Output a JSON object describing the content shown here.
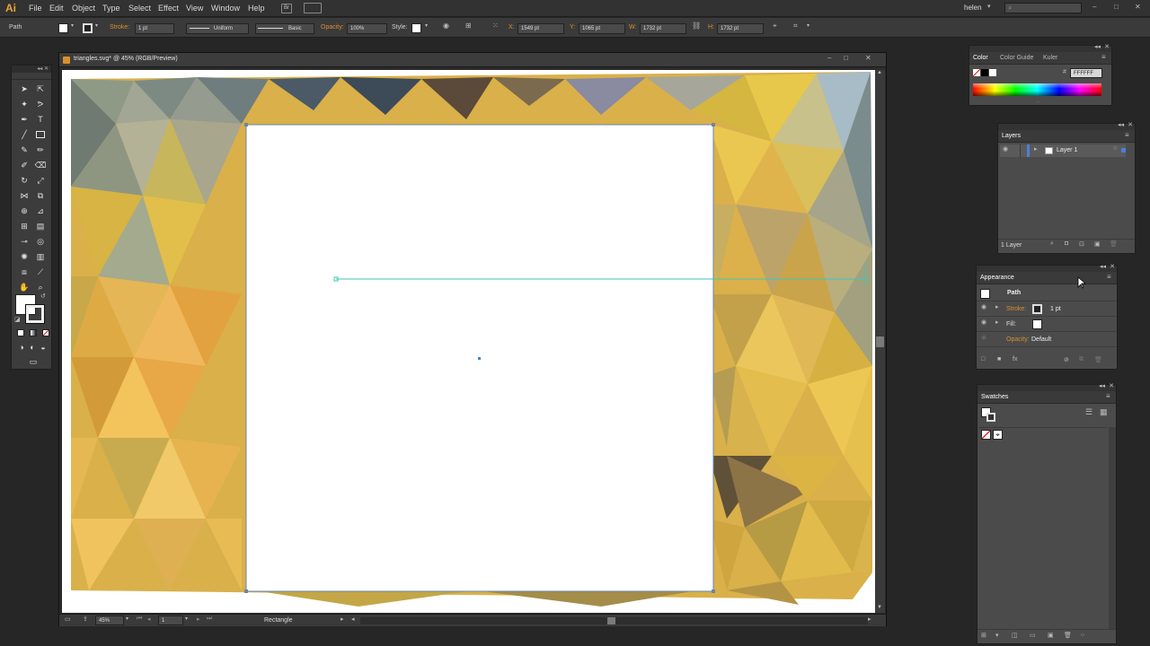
{
  "app": {
    "logo": "Ai"
  },
  "menu": {
    "items": [
      "File",
      "Edit",
      "Object",
      "Type",
      "Select",
      "Effect",
      "View",
      "Window",
      "Help"
    ],
    "bridge": "Br",
    "user": "helen"
  },
  "control": {
    "selection": "Path",
    "stroke_label": "Stroke:",
    "stroke_weight": "1 pt",
    "profile": "Uniform",
    "brush": "Basic",
    "opacity_label": "Opacity:",
    "opacity_value": "100%",
    "style_label": "Style:",
    "x_label": "X:",
    "x_value": "1549 pt",
    "y_label": "Y:",
    "y_value": "1065 pt",
    "w_label": "W:",
    "w_value": "1732 pt",
    "h_label": "H:",
    "h_value": "1732 pt"
  },
  "document": {
    "title": "triangles.svg* @ 45% (RGB/Preview)",
    "zoom": "45%",
    "artboard": "1",
    "status": "Rectangle"
  },
  "color_panel": {
    "tabs": [
      "Color",
      "Color Guide",
      "Kuler"
    ],
    "hex_label": "#",
    "hex": "FFFFFF"
  },
  "layers_panel": {
    "title": "Layers",
    "layer_name": "Layer 1",
    "count": "1 Layer"
  },
  "appearance_panel": {
    "title": "Appearance",
    "object": "Path",
    "stroke_label": "Stroke:",
    "stroke_value": "1 pt",
    "fill_label": "Fill:",
    "opacity_label": "Opacity:",
    "opacity_value": "Default"
  },
  "swatches_panel": {
    "title": "Swatches"
  },
  "colors": {
    "accent_orange": "#d8902c",
    "selection_cyan": "#3fc7b5",
    "artboard_fill": "#ffffff"
  }
}
